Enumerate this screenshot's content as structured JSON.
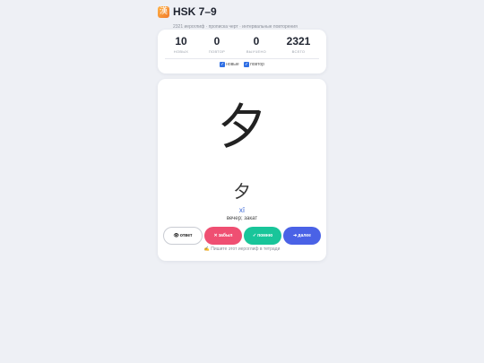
{
  "app": {
    "logo_glyph": "漢",
    "title": "HSK 7–9",
    "subtitle": "2321 иероглиф · прописка черт · интервальные повторения"
  },
  "stats": [
    {
      "value": "10",
      "label": "НОВЫХ"
    },
    {
      "value": "0",
      "label": "ПОВТОР"
    },
    {
      "value": "0",
      "label": "ВЫУЧЕНО"
    },
    {
      "value": "2321",
      "label": "ВСЕГО"
    }
  ],
  "filters": [
    {
      "label": "новые",
      "checked": true
    },
    {
      "label": "повтор",
      "checked": true
    }
  ],
  "card": {
    "hanzi": "夕",
    "hanzi_small": "夕",
    "pinyin": "xī",
    "meaning": "вечер; закат"
  },
  "buttons": {
    "answer": {
      "icon": "👁",
      "label": "ответ"
    },
    "forgot": {
      "icon": "✕",
      "label": "забыл"
    },
    "remember": {
      "icon": "✓",
      "label": "помню"
    },
    "next": {
      "icon": "➜",
      "label": "далее"
    }
  },
  "hint": {
    "icon": "✍",
    "text": "Пишите этот иероглиф в тетради"
  },
  "colors": {
    "accent": "#4a62e6",
    "forgot": "#ef4f72",
    "remember": "#19c59a",
    "pinyin": "#3a66d6"
  }
}
